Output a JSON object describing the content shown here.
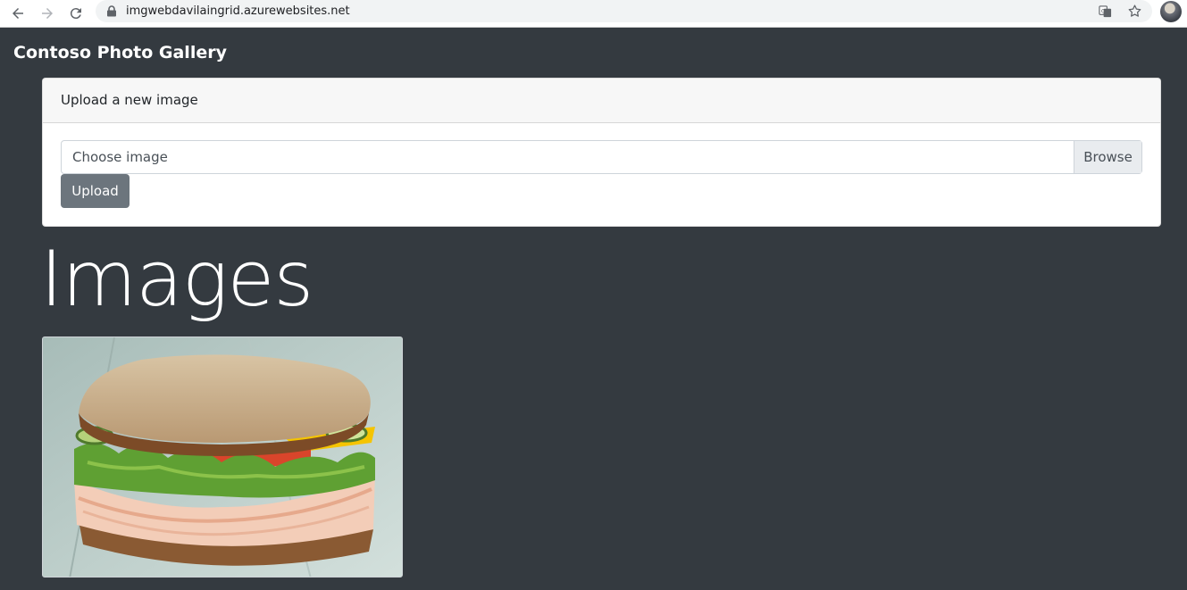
{
  "browser": {
    "url": "imgwebdavilaingrid.azurewebsites.net",
    "icons": [
      "back-icon",
      "forward-icon",
      "reload-icon",
      "lock-icon",
      "translate-icon",
      "star-icon",
      "avatar"
    ]
  },
  "brand": "Contoso Photo Gallery",
  "upload_card": {
    "header": "Upload a new image",
    "file_placeholder": "Choose image",
    "browse_label": "Browse",
    "upload_label": "Upload"
  },
  "gallery": {
    "heading": "Images",
    "images": [
      {
        "subject": "sandwich-photo"
      }
    ]
  },
  "colors": {
    "background": "#343a40",
    "upload_button": "#6c757d",
    "card_header": "#f7f7f7"
  }
}
